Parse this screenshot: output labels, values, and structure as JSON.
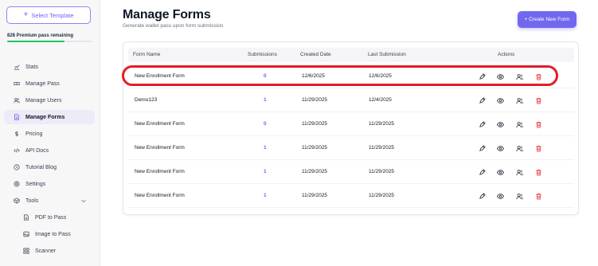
{
  "sidebar": {
    "select_template": "Select Template",
    "premium_text": "828 Premium pass remaining",
    "premium_fraction": 0.68,
    "items": [
      {
        "label": "Stats",
        "icon": "stats-icon"
      },
      {
        "label": "Manage Pass",
        "icon": "pass-icon"
      },
      {
        "label": "Manage Users",
        "icon": "users-icon"
      },
      {
        "label": "Manage Forms",
        "icon": "forms-icon",
        "active": true
      },
      {
        "label": "Pricing",
        "icon": "dollar-icon"
      },
      {
        "label": "API Docs",
        "icon": "code-icon"
      },
      {
        "label": "Tutorial Blog",
        "icon": "blog-icon"
      },
      {
        "label": "Settings",
        "icon": "gear-icon"
      },
      {
        "label": "Tools",
        "icon": "tools-icon"
      }
    ],
    "sub_items": [
      {
        "label": "PDF to Pass",
        "icon": "pdf-icon"
      },
      {
        "label": "Image to Pass",
        "icon": "image-icon"
      },
      {
        "label": "Scanner",
        "icon": "scanner-icon"
      }
    ]
  },
  "header": {
    "title": "Manage Forms",
    "subtitle": "Generate wallet pass upon form submission",
    "create_button": "+ Create New Form"
  },
  "table": {
    "columns": [
      "Form Name",
      "Submissions",
      "Created Date",
      "Last Submission",
      "Actions"
    ],
    "rows": [
      {
        "name": "New Enrollment Form",
        "submissions": "0",
        "created": "12/6/2025",
        "last": "12/6/2025"
      },
      {
        "name": "Demo123",
        "submissions": "1",
        "created": "11/29/2025",
        "last": "12/4/2025"
      },
      {
        "name": "New Enrollment Form",
        "submissions": "0",
        "created": "11/29/2025",
        "last": "11/29/2025"
      },
      {
        "name": "New Enrollment Form",
        "submissions": "1",
        "created": "11/29/2025",
        "last": "11/29/2025"
      },
      {
        "name": "New Enrollment Form",
        "submissions": "1",
        "created": "11/29/2025",
        "last": "11/29/2025"
      },
      {
        "name": "New Enrollment Form",
        "submissions": "1",
        "created": "11/29/2025",
        "last": "11/29/2025"
      }
    ],
    "actions": [
      "edit-icon",
      "view-icon",
      "users-icon",
      "delete-icon"
    ]
  },
  "colors": {
    "accent": "#7268ee",
    "highlight": "#e11d2a",
    "delete": "#ef4444",
    "progress": "#22c55e"
  }
}
